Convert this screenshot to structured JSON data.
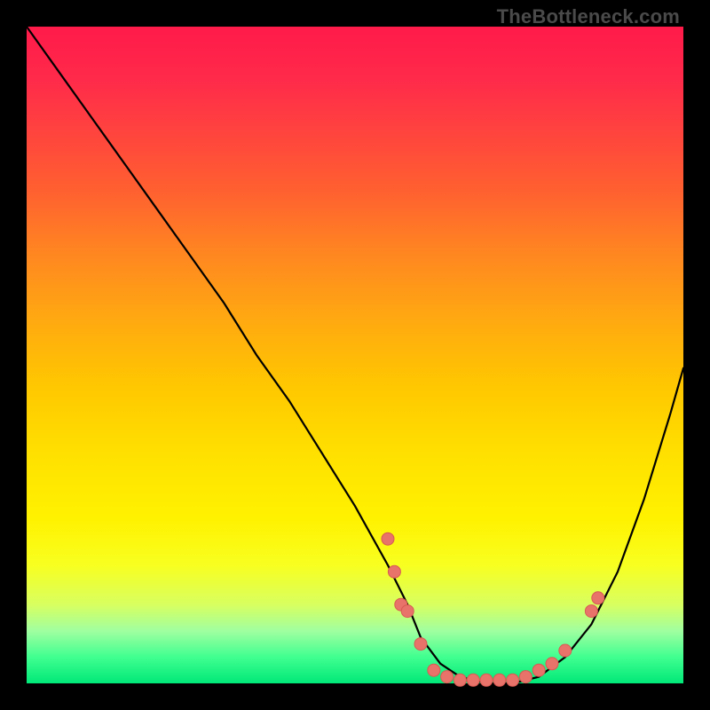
{
  "attribution": "TheBottleneck.com",
  "colors": {
    "gradient_top": "#ff1a4a",
    "gradient_bottom": "#00e878",
    "curve": "#000000",
    "point_fill": "#e8736b",
    "point_stroke": "#d85a52"
  },
  "chart_data": {
    "type": "line",
    "title": "",
    "xlabel": "",
    "ylabel": "",
    "xlim": [
      0,
      100
    ],
    "ylim": [
      0,
      100
    ],
    "curve": {
      "x": [
        0,
        5,
        10,
        15,
        20,
        25,
        30,
        35,
        40,
        45,
        50,
        55,
        58,
        60,
        63,
        66,
        70,
        74,
        78,
        82,
        86,
        90,
        94,
        98,
        100
      ],
      "y": [
        100,
        93,
        86,
        79,
        72,
        65,
        58,
        50,
        43,
        35,
        27,
        18,
        12,
        7,
        3,
        1,
        0,
        0,
        1,
        4,
        9,
        17,
        28,
        41,
        48
      ]
    },
    "points": [
      {
        "x": 55,
        "y": 22
      },
      {
        "x": 56,
        "y": 17
      },
      {
        "x": 57,
        "y": 12
      },
      {
        "x": 58,
        "y": 11
      },
      {
        "x": 60,
        "y": 6
      },
      {
        "x": 62,
        "y": 2
      },
      {
        "x": 64,
        "y": 1
      },
      {
        "x": 66,
        "y": 0.5
      },
      {
        "x": 68,
        "y": 0.5
      },
      {
        "x": 70,
        "y": 0.5
      },
      {
        "x": 72,
        "y": 0.5
      },
      {
        "x": 74,
        "y": 0.5
      },
      {
        "x": 76,
        "y": 1
      },
      {
        "x": 78,
        "y": 2
      },
      {
        "x": 80,
        "y": 3
      },
      {
        "x": 82,
        "y": 5
      },
      {
        "x": 86,
        "y": 11
      },
      {
        "x": 87,
        "y": 13
      }
    ]
  }
}
